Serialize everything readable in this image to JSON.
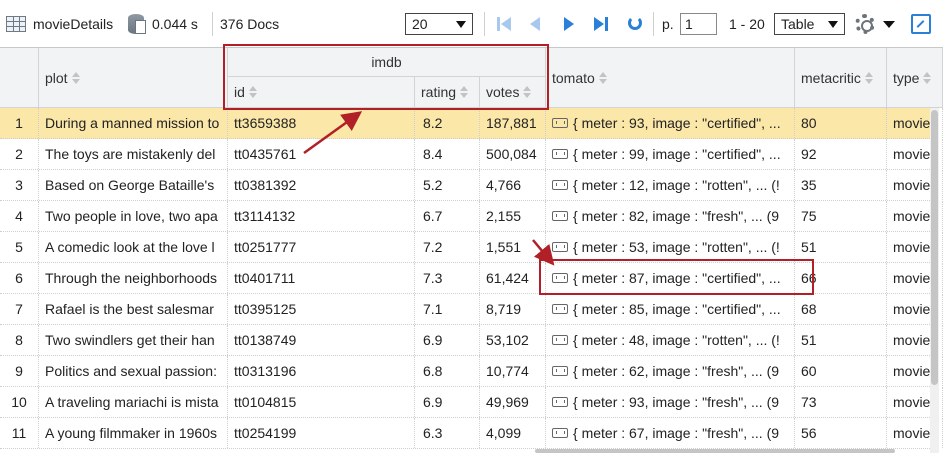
{
  "toolbar": {
    "collection": "movieDetails",
    "time": "0.044 s",
    "docs": "376 Docs",
    "page_size": "20",
    "page_label": "p.",
    "page_value": "1",
    "range": "1 - 20",
    "view": "Table"
  },
  "columns": {
    "plot": "plot",
    "imdb": "imdb",
    "id": "id",
    "rating": "rating",
    "votes": "votes",
    "tomato": "tomato",
    "metacritic": "metacritic",
    "type": "type"
  },
  "rows": [
    {
      "n": "1",
      "plot": "During a manned mission to",
      "id": "tt3659388",
      "rating": "8.2",
      "votes": "187,881",
      "tomato": "{ meter : 93, image : \"certified\", ...",
      "metacritic": "80",
      "type": "movie"
    },
    {
      "n": "2",
      "plot": "The toys are mistakenly del",
      "id": "tt0435761",
      "rating": "8.4",
      "votes": "500,084",
      "tomato": "{ meter : 99, image : \"certified\", ...",
      "metacritic": "92",
      "type": "movie"
    },
    {
      "n": "3",
      "plot": "Based on George Bataille's",
      "id": "tt0381392",
      "rating": "5.2",
      "votes": "4,766",
      "tomato": "{ meter : 12, image : \"rotten\", ... (!",
      "metacritic": "35",
      "type": "movie"
    },
    {
      "n": "4",
      "plot": "Two people in love, two apa",
      "id": "tt3114132",
      "rating": "6.7",
      "votes": "2,155",
      "tomato": "{ meter : 82, image : \"fresh\", ... (9",
      "metacritic": "75",
      "type": "movie"
    },
    {
      "n": "5",
      "plot": "A comedic look at the love l",
      "id": "tt0251777",
      "rating": "7.2",
      "votes": "1,551",
      "tomato": "{ meter : 53, image : \"rotten\", ... (!",
      "metacritic": "51",
      "type": "movie"
    },
    {
      "n": "6",
      "plot": "Through the neighborhoods",
      "id": "tt0401711",
      "rating": "7.3",
      "votes": "61,424",
      "tomato": "{ meter : 87, image : \"certified\", ...",
      "metacritic": "66",
      "type": "movie"
    },
    {
      "n": "7",
      "plot": "Rafael is the best salesmar",
      "id": "tt0395125",
      "rating": "7.1",
      "votes": "8,719",
      "tomato": "{ meter : 85, image : \"certified\", ...",
      "metacritic": "68",
      "type": "movie"
    },
    {
      "n": "8",
      "plot": "Two swindlers get their han",
      "id": "tt0138749",
      "rating": "6.9",
      "votes": "53,102",
      "tomato": "{ meter : 48, image : \"rotten\", ... (!",
      "metacritic": "51",
      "type": "movie"
    },
    {
      "n": "9",
      "plot": "Politics and sexual passion:",
      "id": "tt0313196",
      "rating": "6.8",
      "votes": "10,774",
      "tomato": "{ meter : 62, image : \"fresh\", ... (9",
      "metacritic": "60",
      "type": "movie"
    },
    {
      "n": "10",
      "plot": "A traveling mariachi is mista",
      "id": "tt0104815",
      "rating": "6.9",
      "votes": "49,969",
      "tomato": "{ meter : 93, image : \"fresh\", ... (9",
      "metacritic": "73",
      "type": "movie"
    },
    {
      "n": "11",
      "plot": "A young filmmaker in 1960s",
      "id": "tt0254199",
      "rating": "6.3",
      "votes": "4,099",
      "tomato": "{ meter : 67, image : \"fresh\", ... (9",
      "metacritic": "56",
      "type": "movie"
    }
  ],
  "colors": {
    "selected_row": "#fbe7a8",
    "annotation": "#b02026",
    "accent": "#2a7fd8"
  }
}
